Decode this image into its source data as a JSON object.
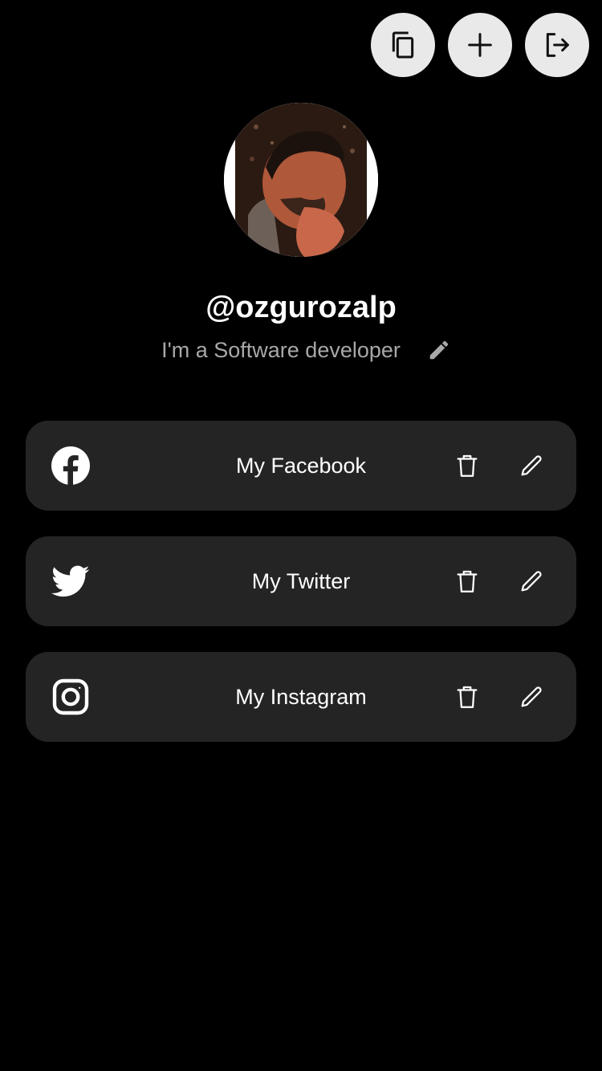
{
  "header": {
    "actions": [
      {
        "icon": "copy-icon"
      },
      {
        "icon": "plus-icon"
      },
      {
        "icon": "logout-icon"
      }
    ]
  },
  "profile": {
    "username": "@ozgurozalp",
    "bio": "I'm a Software developer",
    "bio_edit_icon": "pencil-icon"
  },
  "links": [
    {
      "label": "My Facebook",
      "icon": "facebook-icon"
    },
    {
      "label": "My Twitter",
      "icon": "twitter-icon"
    },
    {
      "label": "My Instagram",
      "icon": "instagram-icon"
    }
  ],
  "colors": {
    "background": "#000000",
    "card": "#242424",
    "action_button": "#e9e9e9",
    "bio_text": "#a8a8a8"
  }
}
